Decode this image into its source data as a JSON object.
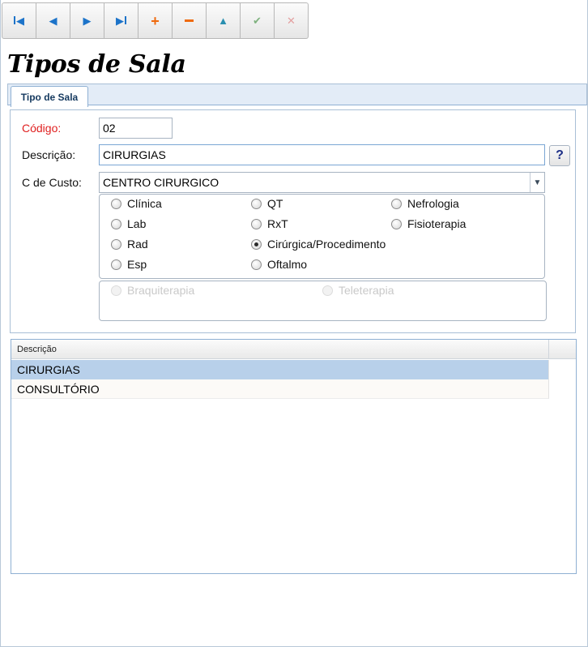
{
  "toolbar": {
    "buttons": [
      {
        "icon": "first-record-icon"
      },
      {
        "icon": "previous-record-icon"
      },
      {
        "icon": "next-record-icon"
      },
      {
        "icon": "last-record-icon"
      },
      {
        "icon": "add-icon"
      },
      {
        "icon": "delete-icon"
      },
      {
        "icon": "edit-icon"
      },
      {
        "icon": "confirm-icon"
      },
      {
        "icon": "cancel-icon"
      }
    ]
  },
  "page": {
    "title": "Tipos de Sala"
  },
  "tabs": [
    {
      "label": "Tipo de Sala"
    }
  ],
  "form": {
    "codigo": {
      "label": "Código:",
      "value": "02"
    },
    "descricao": {
      "label": "Descrição:",
      "value": "CIRURGIAS",
      "help": "?"
    },
    "custo": {
      "label": "C de Custo:",
      "value": "CENTRO CIRURGICO"
    },
    "radios": [
      {
        "label": "Clínica",
        "checked": false
      },
      {
        "label": "QT",
        "checked": false
      },
      {
        "label": "Nefrologia",
        "checked": false
      },
      {
        "label": "Lab",
        "checked": false
      },
      {
        "label": "RxT",
        "checked": false
      },
      {
        "label": "Fisioterapia",
        "checked": false
      },
      {
        "label": "Rad",
        "checked": false
      },
      {
        "label": "Cirúrgica/Procedimento",
        "checked": true
      },
      {
        "label": "Esp",
        "checked": false
      },
      {
        "label": "Oftalmo",
        "checked": false
      }
    ],
    "disabled_radios": [
      {
        "label": "Braquiterapia"
      },
      {
        "label": "Teleterapia"
      }
    ]
  },
  "grid": {
    "header": "Descrição",
    "rows": [
      {
        "descricao": "CIRURGIAS",
        "selected": true
      },
      {
        "descricao": "CONSULTÓRIO",
        "selected": false
      }
    ]
  },
  "colors": {
    "accent": "#1c73c9",
    "required_label": "#e02020",
    "selected_row": "#b8d0ea"
  }
}
